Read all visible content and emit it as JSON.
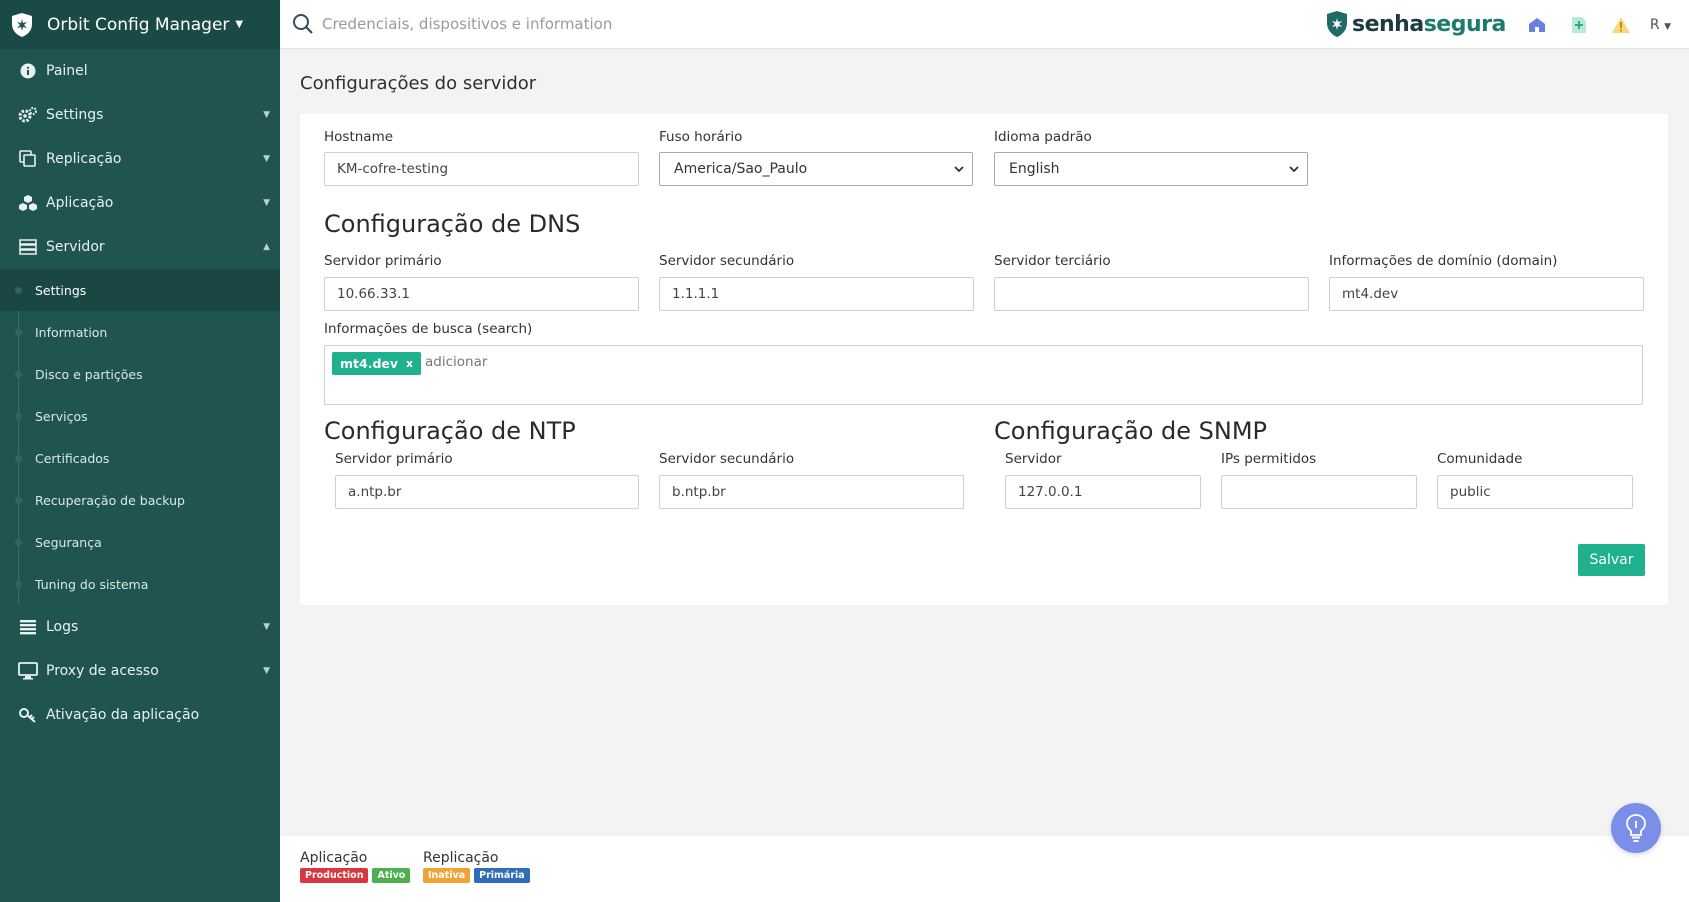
{
  "app": {
    "title": "Orbit Config Manager",
    "brand_part1": "senha",
    "brand_part2": "segura",
    "user_initial": "R"
  },
  "search": {
    "placeholder": "Credenciais, dispositivos e information"
  },
  "sidebar": {
    "items": [
      {
        "label": "Painel",
        "icon": "info-icon"
      },
      {
        "label": "Settings",
        "icon": "gears-icon"
      },
      {
        "label": "Replicação",
        "icon": "copy-icon"
      },
      {
        "label": "Aplicação",
        "icon": "cubes-icon"
      },
      {
        "label": "Servidor",
        "icon": "server-icon"
      },
      {
        "label": "Logs",
        "icon": "list-icon"
      },
      {
        "label": "Proxy de acesso",
        "icon": "monitor-icon"
      },
      {
        "label": "Ativação da aplicação",
        "icon": "key-icon"
      }
    ],
    "server_submenu": [
      "Settings",
      "Information",
      "Disco e partições",
      "Serviços",
      "Certificados",
      "Recuperação de backup",
      "Segurança",
      "Tuning do sistema"
    ]
  },
  "page": {
    "title": "Configurações do servidor"
  },
  "form": {
    "hostname_label": "Hostname",
    "hostname_value": "KM-cofre-testing",
    "timezone_label": "Fuso horário",
    "timezone_value": "America/Sao_Paulo",
    "language_label": "Idioma padrão",
    "language_value": "English",
    "dns_title": "Configuração de DNS",
    "dns_primary_label": "Servidor primário",
    "dns_primary_value": "10.66.33.1",
    "dns_secondary_label": "Servidor secundário",
    "dns_secondary_value": "1.1.1.1",
    "dns_tertiary_label": "Servidor terciário",
    "dns_tertiary_value": "",
    "domain_label": "Informações de domínio (domain)",
    "domain_value": "mt4.dev",
    "search_label": "Informações de busca (search)",
    "search_tag": "mt4.dev",
    "search_tag_remove": "x",
    "search_add_placeholder": "adicionar",
    "ntp_title": "Configuração de NTP",
    "ntp_primary_label": "Servidor primário",
    "ntp_primary_value": "a.ntp.br",
    "ntp_secondary_label": "Servidor secundário",
    "ntp_secondary_value": "b.ntp.br",
    "snmp_title": "Configuração de SNMP",
    "snmp_server_label": "Servidor",
    "snmp_server_value": "127.0.0.1",
    "snmp_ips_label": "IPs permitidos",
    "snmp_ips_value": "",
    "snmp_community_label": "Comunidade",
    "snmp_community_value": "public",
    "save_label": "Salvar"
  },
  "footer": {
    "app_title": "Aplicação",
    "app_badges": [
      {
        "label": "Production",
        "color": "#d9363e"
      },
      {
        "label": "Ativo",
        "color": "#4caf50"
      }
    ],
    "repl_title": "Replicação",
    "repl_badges": [
      {
        "label": "Inativa",
        "color": "#f0a437"
      },
      {
        "label": "Primária",
        "color": "#2f6db5"
      }
    ]
  },
  "colors": {
    "sidebar": "#1f5450",
    "accent": "#1fb08d",
    "fab": "#7b8fe8"
  }
}
